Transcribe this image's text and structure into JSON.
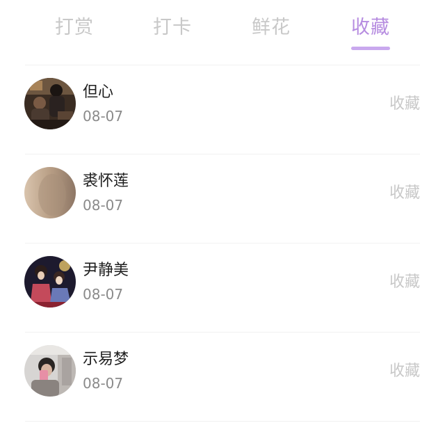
{
  "tabs": [
    {
      "label": "打赏",
      "active": false
    },
    {
      "label": "打卡",
      "active": false
    },
    {
      "label": "鲜花",
      "active": false
    },
    {
      "label": "收藏",
      "active": true
    }
  ],
  "colors": {
    "active_tab": "#b68ce0",
    "inactive_tab": "#c8c8c8",
    "underline": "#c9a8ee"
  },
  "list": {
    "items": [
      {
        "name": "但心",
        "date": "08-07",
        "action": "收藏",
        "avatar_icon": "photo-avatar-icon"
      },
      {
        "name": "裘怀莲",
        "date": "08-07",
        "action": "收藏",
        "avatar_icon": "blurred-avatar-icon"
      },
      {
        "name": "尹静美",
        "date": "08-07",
        "action": "收藏",
        "avatar_icon": "illustration-avatar-icon"
      },
      {
        "name": "示易梦",
        "date": "08-07",
        "action": "收藏",
        "avatar_icon": "selfie-avatar-icon"
      }
    ]
  }
}
